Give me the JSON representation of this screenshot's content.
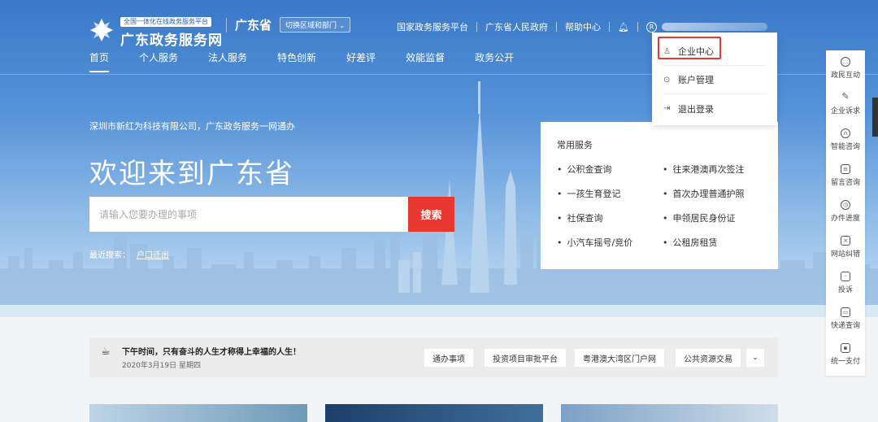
{
  "header": {
    "logo_tag": "全国一体化在线政务服务平台",
    "logo_name": "广东政务服务网",
    "region_name": "广东省",
    "region_switch": "切换区域和部门 ⌄",
    "top_links": [
      "国家政务服务平台",
      "广东省人民政府",
      "帮助中心"
    ],
    "bell_icon": "bell-icon",
    "user_icon": "user-circle-icon"
  },
  "nav": {
    "items": [
      "首页",
      "个人服务",
      "法人服务",
      "特色创新",
      "好差评",
      "效能监督",
      "政务公开"
    ]
  },
  "hero": {
    "greeting": "深圳市新红为科技有限公司，广东政务服务一网通办",
    "title": "欢迎来到广东省",
    "search_placeholder": "请输入您要办理的事项",
    "search_button": "搜索",
    "recent_label": "最近搜索：",
    "recent_link": "户口迁出"
  },
  "services": {
    "title": "常用服务",
    "items": [
      "公积金查询",
      "往来港澳再次签注",
      "一孩生育登记",
      "首次办理普通护照",
      "社保查询",
      "申领居民身份证",
      "小汽车摇号/竞价",
      "公租房租赁"
    ]
  },
  "dropdown": {
    "items": [
      {
        "label": "企业中心",
        "icon": "user-icon"
      },
      {
        "label": "账户管理",
        "icon": "settings-icon"
      },
      {
        "label": "退出登录",
        "icon": "logout-icon"
      }
    ]
  },
  "sidebar": {
    "items": [
      {
        "label": "政民互动",
        "icon": "chat-icon"
      },
      {
        "label": "企业诉求",
        "icon": "edit-icon"
      },
      {
        "label": "智能咨询",
        "icon": "headset-icon"
      },
      {
        "label": "留言咨询",
        "icon": "message-icon"
      },
      {
        "label": "办件进度",
        "icon": "clock-icon"
      },
      {
        "label": "网站纠错",
        "icon": "error-report-icon"
      },
      {
        "label": "投诉",
        "icon": "complaint-icon"
      },
      {
        "label": "快递查询",
        "icon": "truck-icon"
      },
      {
        "label": "统一支付",
        "icon": "payment-icon"
      }
    ]
  },
  "notice": {
    "message": "下午时间，只有奋斗的人生才称得上幸福的人生！",
    "date": "2020年3月19日 星期四",
    "quick_links": [
      "通办事项",
      "投资项目审批平台",
      "粤港澳大湾区门户网",
      "公共资源交易"
    ],
    "more_icon": "chevron-down-icon"
  },
  "colors": {
    "accent_red": "#e8372f",
    "header_blue": "#3a79c9"
  }
}
